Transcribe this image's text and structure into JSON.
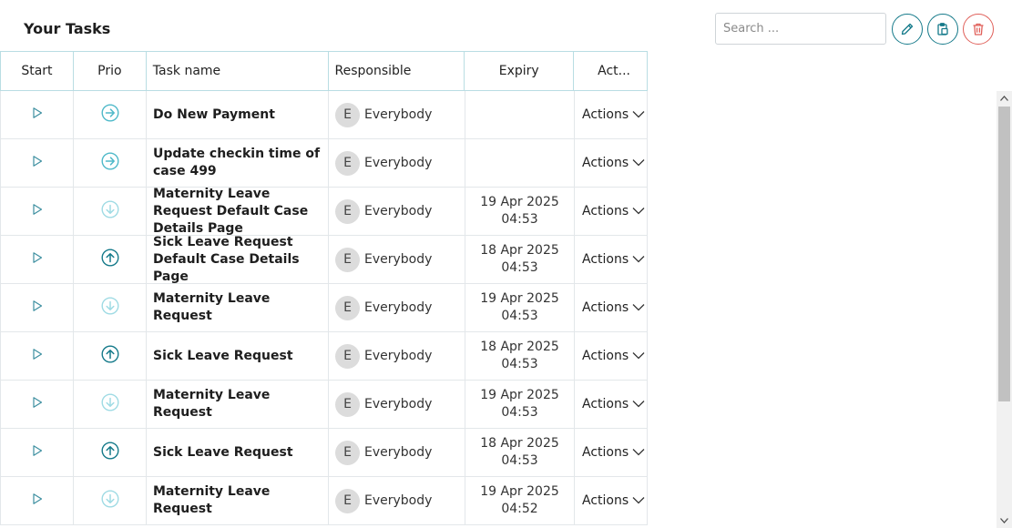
{
  "page": {
    "title": "Your Tasks"
  },
  "toolbar": {
    "search_placeholder": "Search ...",
    "edit_icon": "pencil-icon",
    "copy_icon": "clipboard-copy-icon",
    "delete_icon": "trash-icon"
  },
  "columns": {
    "start": "Start",
    "prio": "Prio",
    "name": "Task name",
    "responsible": "Responsible",
    "expiry": "Expiry",
    "actions": "Act..."
  },
  "colors": {
    "accent": "#157a8a",
    "danger": "#e0605a",
    "prio_high": "#157a8a",
    "prio_normal": "#4fb9c9",
    "prio_low": "#9fdbe4"
  },
  "rows": [
    {
      "name": "Do New Payment",
      "prio": "normal",
      "avatar": "E",
      "responsible": "Everybody",
      "expiry_date": "",
      "expiry_time": "",
      "actions": "Actions"
    },
    {
      "name": "Update checkin time of case 499",
      "prio": "normal",
      "avatar": "E",
      "responsible": "Everybody",
      "expiry_date": "",
      "expiry_time": "",
      "actions": "Actions"
    },
    {
      "name": "Maternity Leave Request Default Case Details Page",
      "prio": "low",
      "avatar": "E",
      "responsible": "Everybody",
      "expiry_date": "19 Apr 2025",
      "expiry_time": "04:53",
      "actions": "Actions"
    },
    {
      "name": "Sick Leave Request Default Case Details Page",
      "prio": "high",
      "avatar": "E",
      "responsible": "Everybody",
      "expiry_date": "18 Apr 2025",
      "expiry_time": "04:53",
      "actions": "Actions"
    },
    {
      "name": "Maternity Leave Request",
      "prio": "low",
      "avatar": "E",
      "responsible": "Everybody",
      "expiry_date": "19 Apr 2025",
      "expiry_time": "04:53",
      "actions": "Actions"
    },
    {
      "name": "Sick Leave Request",
      "prio": "high",
      "avatar": "E",
      "responsible": "Everybody",
      "expiry_date": "18 Apr 2025",
      "expiry_time": "04:53",
      "actions": "Actions"
    },
    {
      "name": "Maternity Leave Request",
      "prio": "low",
      "avatar": "E",
      "responsible": "Everybody",
      "expiry_date": "19 Apr 2025",
      "expiry_time": "04:53",
      "actions": "Actions"
    },
    {
      "name": "Sick Leave Request",
      "prio": "high",
      "avatar": "E",
      "responsible": "Everybody",
      "expiry_date": "18 Apr 2025",
      "expiry_time": "04:53",
      "actions": "Actions"
    },
    {
      "name": "Maternity Leave Request",
      "prio": "low",
      "avatar": "E",
      "responsible": "Everybody",
      "expiry_date": "19 Apr 2025",
      "expiry_time": "04:52",
      "actions": "Actions"
    }
  ]
}
